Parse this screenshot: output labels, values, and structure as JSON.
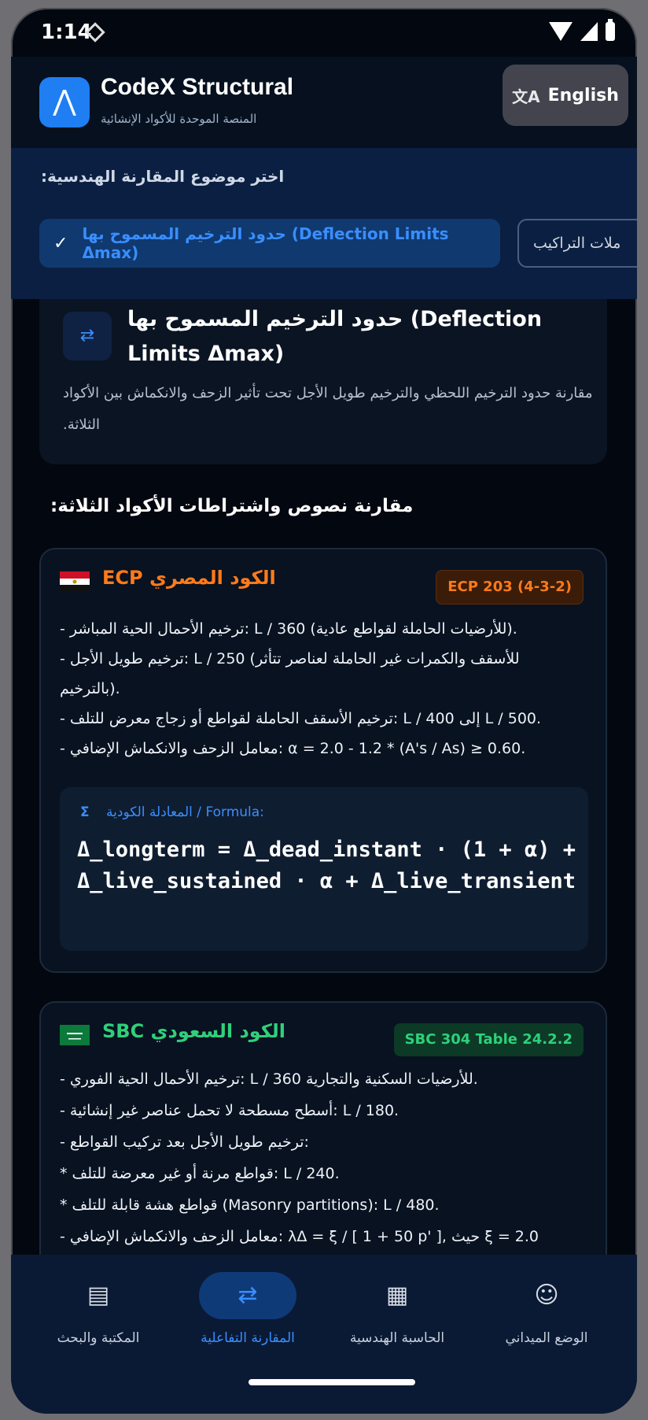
{
  "status": {
    "time": "1:14"
  },
  "header": {
    "title": "CodeX Structural",
    "subtitle": "المنصة الموحدة للأكواد الإنشائية",
    "lang_button": "English"
  },
  "selector": {
    "label": "اختر موضوع المقارنة الهندسية:",
    "active_chip": "حدود الترخيم المسموح بها (Deflection Limits Δmax)",
    "other_chip": "ملات التراكيب"
  },
  "topic": {
    "title": "حدود الترخيم المسموح بها (Deflection Limits Δmax)",
    "description": "مقارنة حدود الترخيم اللحظي والترخيم طويل الأجل تحت تأثير الزحف والانكماش بين الأكواد الثلاثة."
  },
  "section_title": "مقارنة نصوص واشتراطات الأكواد الثلاثة:",
  "ecp": {
    "name": "ECP الكود المصري",
    "ref": "ECP 203 (4-3-2)",
    "lines": [
      "- ترخيم الأحمال الحية المباشر: L / 360 (للأرضيات الحاملة لقواطع عادية).",
      "- ترخيم طويل الأجل: L / 250 (للأسقف والكمرات غير الحاملة لعناصر تتأثر",
      "بالترخيم).",
      "- ترخيم الأسقف الحاملة لقواطع أو زجاج معرض للتلف: L / 400 إلى L / 500.",
      "- معامل الزحف والانكماش الإضافي: α = 2.0 - 1.2 * (A's / As) ≥ 0.60."
    ],
    "formula_label": "المعادلة الكودية / Formula:",
    "formula": "Δ_longterm = Δ_dead_instant · (1 + α) + Δ_live_sustained · α + Δ_live_transient"
  },
  "sbc": {
    "name": "SBC الكود السعودي",
    "ref": "SBC 304 Table 24.2.2",
    "lines": [
      "- ترخيم الأحمال الحية الفوري: L / 360 للأرضيات السكنية والتجارية.",
      "- أسطح مسطحة لا تحمل عناصر غير إنشائية: L / 180.",
      "- ترخيم طويل الأجل بعد تركيب القواطع:",
      "  * قواطع مرنة أو غير معرضة للتلف: L / 240.",
      "  * قواطع هشة قابلة للتلف (Masonry partitions): L / 480.",
      "- معامل الزحف والانكماش الإضافي: λΔ = ξ / [ 1 + 50 p' ], حيث ξ = 2.0"
    ]
  },
  "nav": {
    "library": "المكتبة والبحث",
    "comparison": "المقارنة التفاعلية",
    "calculator": "الحاسبة الهندسية",
    "field": "الوضع الميداني"
  },
  "colors": {
    "accent": "#3a8eff",
    "ecp": "#ff7a1a",
    "sbc": "#2fd07a",
    "background": "#03070f"
  }
}
